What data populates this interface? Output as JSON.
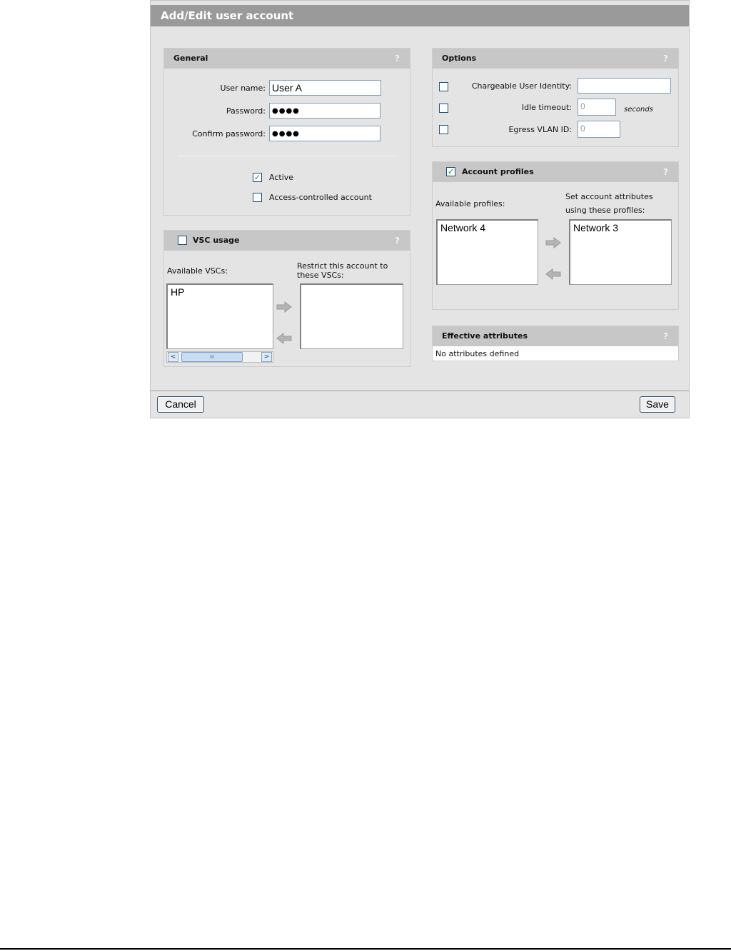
{
  "window": {
    "title": "Add/Edit user account"
  },
  "general": {
    "title": "General",
    "help": "?",
    "user_name_label": "User name:",
    "user_name_value": "User A",
    "password_label": "Password:",
    "password_value": "●●●●",
    "confirm_label": "Confirm password:",
    "confirm_value": "●●●●",
    "active_label": "Active",
    "active_checked": true,
    "access_label": "Access-controlled account",
    "access_checked": false
  },
  "vsc": {
    "title": "VSC usage",
    "help": "?",
    "available_label": "Available VSCs:",
    "restrict_label_1": "Restrict this account to",
    "restrict_label_2": "these VSCs:",
    "available_items": [
      "HP"
    ],
    "scroll_thumb": "III"
  },
  "options": {
    "title": "Options",
    "help": "?",
    "cui_label": "Chargeable User Identity:",
    "cui_value": "",
    "idle_label": "Idle timeout:",
    "idle_value": "0",
    "idle_unit": "seconds",
    "egress_label": "Egress VLAN ID:",
    "egress_value": "0"
  },
  "profiles": {
    "title": "Account profiles",
    "help": "?",
    "available_label": "Available profiles:",
    "set_label_1": "Set account attributes",
    "set_label_2": "using these profiles:",
    "available_items": [
      "Network 4"
    ],
    "selected_items": [
      "Network 3"
    ]
  },
  "effective": {
    "title": "Effective attributes",
    "help": "?",
    "text": "No attributes defined"
  },
  "footer": {
    "cancel_label": "Cancel",
    "save_label": "Save"
  },
  "icons": {
    "check": "✓",
    "arrow_right": "arrow-right-icon",
    "arrow_left": "arrow-left-icon"
  }
}
